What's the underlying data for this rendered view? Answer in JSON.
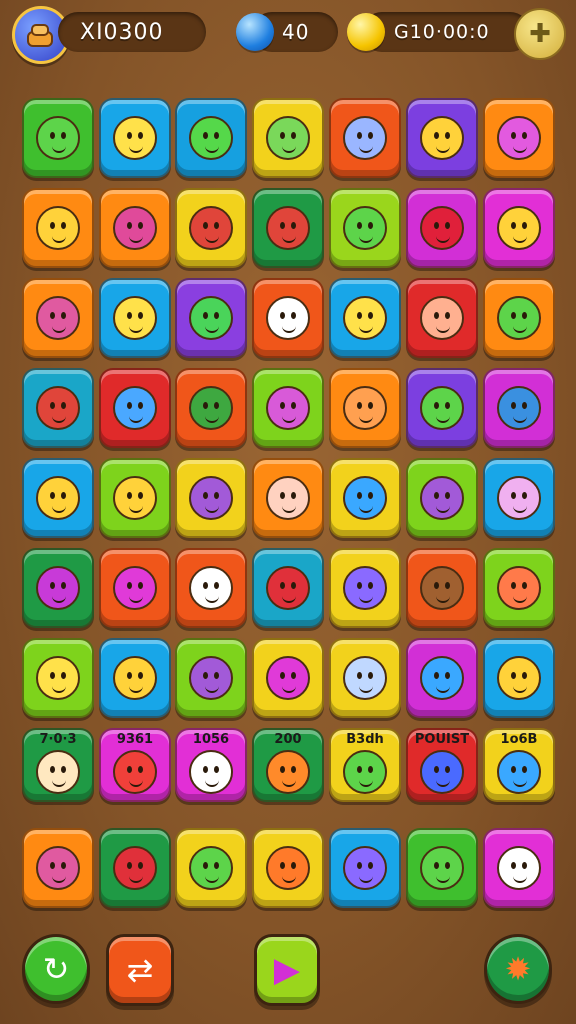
{
  "hud": {
    "score": "XI0300",
    "gems": "40",
    "coins": "G10·00:0"
  },
  "icons": {
    "score_badge": "pancake-badge-icon",
    "gem": "blue-gem-icon",
    "coin": "gold-coin-icon",
    "puzzle": "puzzle-piece-icon"
  },
  "tiles": [
    [
      "#3fbf2e",
      "#18a6e8",
      "#16a0e0",
      "#f2d21c",
      "#f0561a",
      "#7c3fe0",
      "#ff8a12"
    ],
    [
      "#ff8a12",
      "#ff8a12",
      "#f2d21c",
      "#1f9a45",
      "#9ad61c",
      "#d22fd6",
      "#e22fd6"
    ],
    [
      "#ff8a12",
      "#18a6e8",
      "#8a3fe0",
      "#f0561a",
      "#18a6e8",
      "#e02a2a",
      "#ff8a12"
    ],
    [
      "#1aa6c8",
      "#e02a2a",
      "#f0561a",
      "#7ed31c",
      "#ff8a12",
      "#7c3fe0",
      "#d22fd6"
    ],
    [
      "#18a6e8",
      "#7ed31c",
      "#f2d21c",
      "#ff8a12",
      "#f2d21c",
      "#7ed31c",
      "#18a6e8"
    ],
    [
      "#1f9a45",
      "#f0561a",
      "#f0561a",
      "#1aa6c8",
      "#f2d21c",
      "#f0561a",
      "#7ed31c"
    ],
    [
      "#7ed31c",
      "#18a6e8",
      "#7ed31c",
      "#f2d21c",
      "#f2d21c",
      "#d22fd6",
      "#18a6e8"
    ],
    [
      "#1f9a45",
      "#e22fd6",
      "#e22fd6",
      "#1f9a45",
      "#f2d21c",
      "#e02a2a",
      "#f2d21c"
    ],
    [
      "#ff8a12",
      "#1f9a45",
      "#f2d21c",
      "#f2d21c",
      "#18a6e8",
      "#3fbf2e",
      "#e22fd6"
    ]
  ],
  "faces": [
    [
      "#5dd44a",
      "#ffe14a",
      "#55d84a",
      "#7ad85a",
      "#9ab6ff",
      "#ffd23a",
      "#e25adf"
    ],
    [
      "#ffd23a",
      "#e04a9a",
      "#e0453a",
      "#e0453a",
      "#5dd44a",
      "#e0203a",
      "#ffd23a"
    ],
    [
      "#e05aa0",
      "#ffe14a",
      "#4ad45a",
      "#ffffff",
      "#ffe14a",
      "#ffb090",
      "#5dd44a"
    ],
    [
      "#e0453a",
      "#4aa8ff",
      "#3ea840",
      "#d85ad8",
      "#ffa050",
      "#5dd44a",
      "#3a90e0"
    ],
    [
      "#ffd23a",
      "#ffd23a",
      "#a25ad8",
      "#ffd2c0",
      "#3aa8ff",
      "#a25ad8",
      "#f0b0f0"
    ],
    [
      "#c83ad8",
      "#e03ad8",
      "#ffffff",
      "#e0303a",
      "#8a6aff",
      "#a06030",
      "#ff7a4a"
    ],
    [
      "#ffe14a",
      "#ffd23a",
      "#a25ad8",
      "#e03ad8",
      "#c0d8ff",
      "#3aa8ff",
      "#ffd23a"
    ],
    [
      "#ffe8c0",
      "#f0403a",
      "#ffffff",
      "#ff8a2a",
      "#5dd44a",
      "#4a6aff",
      "#3aa8ff"
    ],
    [
      "#e05aa0",
      "#e0303a",
      "#5dd44a",
      "#ff7a2a",
      "#8a6aff",
      "#5dd44a",
      "#ffffff"
    ]
  ],
  "row8_labels": [
    "7·0·3",
    "9361",
    "1056",
    "200",
    "B3dh",
    "POUIST",
    "1o6B"
  ],
  "buttons": {
    "restart_icon": "restart-icon",
    "shuffle_icon": "shuffle-icon",
    "play_icon": "play-icon",
    "settings_icon": "gear-icon"
  }
}
